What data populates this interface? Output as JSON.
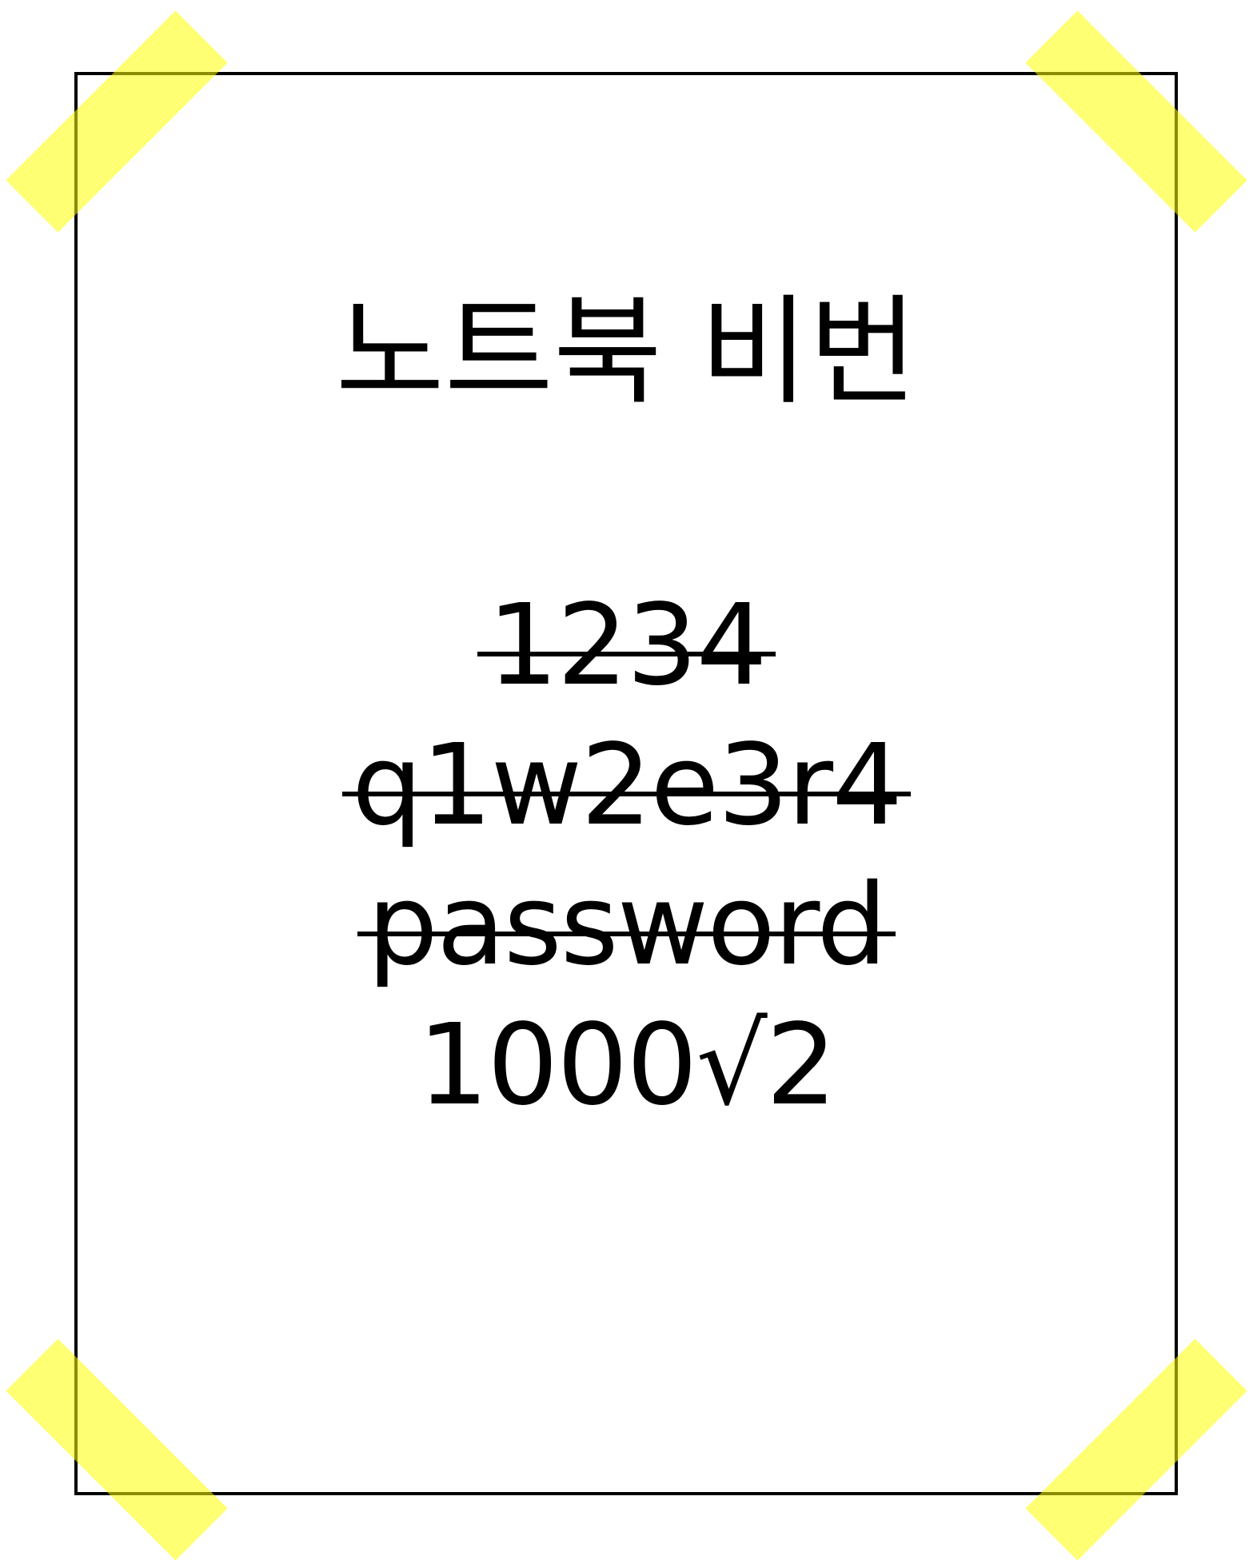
{
  "note": {
    "title": "노트북 비번",
    "passwords": [
      {
        "text": "1234",
        "struck": true
      },
      {
        "text": "q1w2e3r4",
        "struck": true
      },
      {
        "text": "password",
        "struck": true
      },
      {
        "text": "1000√2",
        "struck": false
      }
    ]
  },
  "colors": {
    "tape": "#ffff00",
    "border": "#000000",
    "text": "#000000",
    "background": "#ffffff"
  }
}
